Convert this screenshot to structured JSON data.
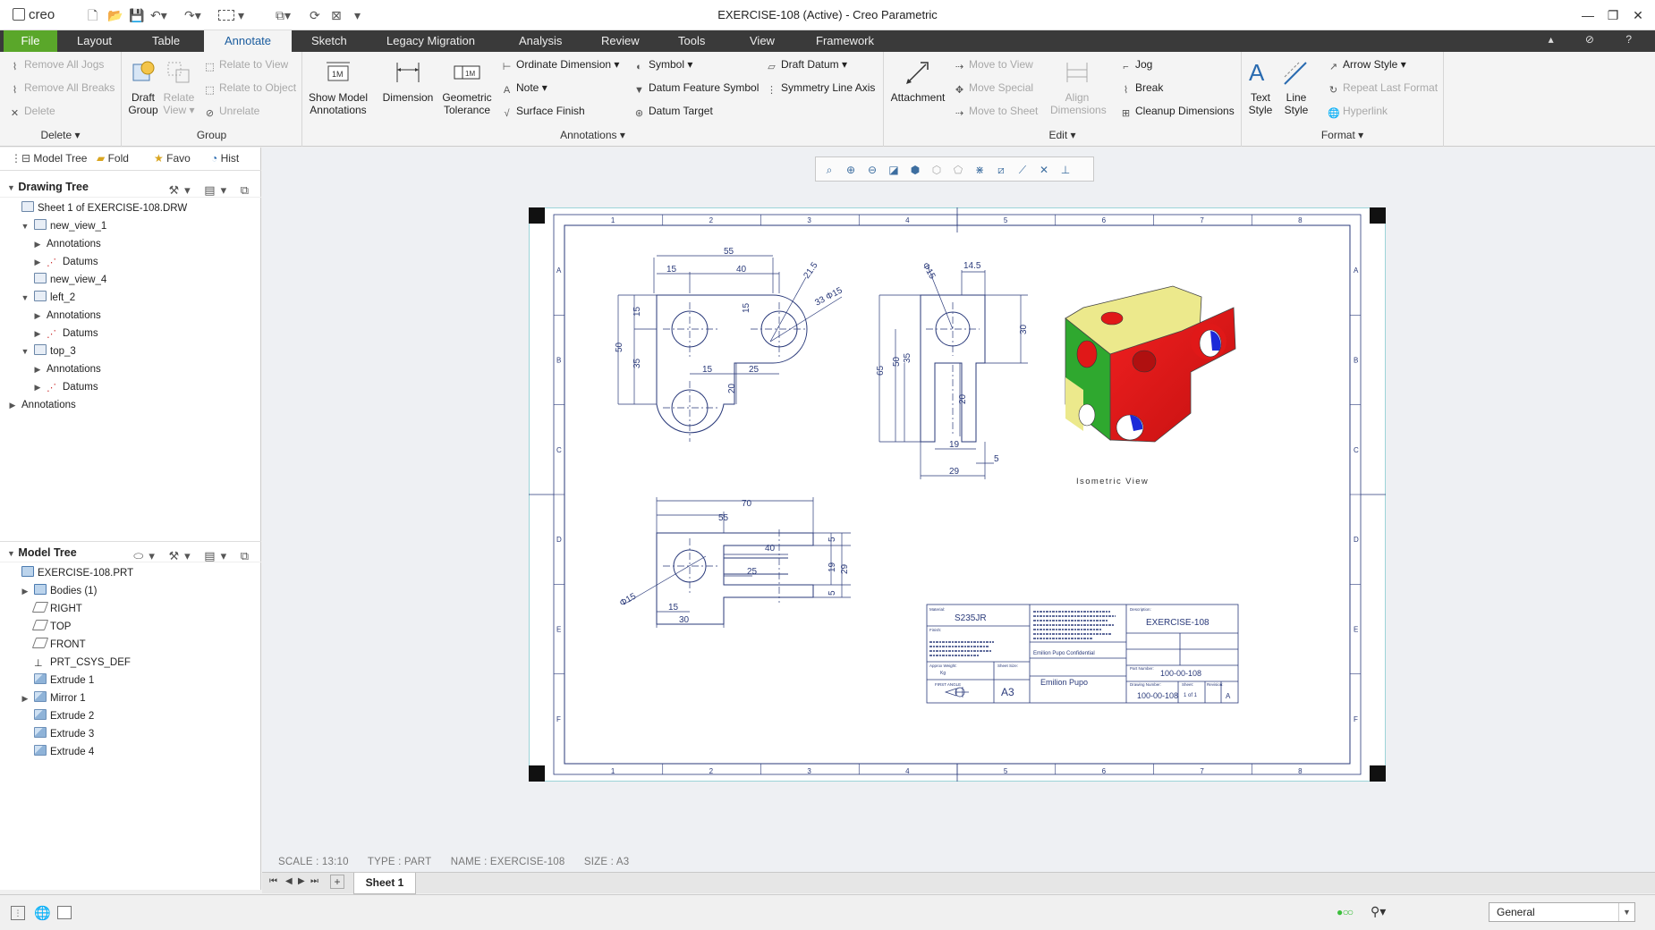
{
  "app": {
    "logo": "creo",
    "window_title": "EXERCISE-108 (Active) - Creo Parametric"
  },
  "tabs": [
    {
      "label": "File"
    },
    {
      "label": "Layout"
    },
    {
      "label": "Table"
    },
    {
      "label": "Annotate"
    },
    {
      "label": "Sketch"
    },
    {
      "label": "Legacy Migration"
    },
    {
      "label": "Analysis"
    },
    {
      "label": "Review"
    },
    {
      "label": "Tools"
    },
    {
      "label": "View"
    },
    {
      "label": "Framework"
    }
  ],
  "active_tab": "Annotate",
  "ribbon": {
    "delete_group": {
      "remove_all_jogs": "Remove All Jogs",
      "remove_all_breaks": "Remove All Breaks",
      "delete": "Delete",
      "label": "Delete"
    },
    "group_group": {
      "draft_group": [
        "Draft",
        "Group"
      ],
      "relate_view": [
        "Relate",
        "View"
      ],
      "relate_to_view": "Relate to View",
      "relate_to_object": "Relate to Object",
      "unrelate": "Unrelate",
      "label": "Group"
    },
    "annotations_group": {
      "show_model_annotations": [
        "Show Model",
        "Annotations"
      ],
      "dimension": "Dimension",
      "geometric_tolerance": [
        "Geometric",
        "Tolerance"
      ],
      "ordinate_dimension": "Ordinate Dimension",
      "note": "Note",
      "surface_finish": "Surface Finish",
      "symbol": "Symbol",
      "datum_feature_symbol": "Datum Feature Symbol",
      "datum_target": "Datum Target",
      "draft_datum": "Draft Datum",
      "symmetry_line_axis": "Symmetry Line Axis",
      "label": "Annotations"
    },
    "edit_group": {
      "attachment": "Attachment",
      "move_to_view": "Move to View",
      "move_special": "Move Special",
      "move_to_sheet": "Move to Sheet",
      "align_dimensions": [
        "Align",
        "Dimensions"
      ],
      "jog": "Jog",
      "break": "Break",
      "cleanup_dimensions": "Cleanup Dimensions",
      "label": "Edit"
    },
    "format_group": {
      "text_style": [
        "Text",
        "Style"
      ],
      "line_style": [
        "Line",
        "Style"
      ],
      "arrow_style": "Arrow Style",
      "repeat_last_format": "Repeat Last Format",
      "hyperlink": "Hyperlink",
      "label": "Format"
    }
  },
  "left_pane": {
    "tabs": [
      {
        "label": "Model Tree",
        "icon": "model-tree-icon"
      },
      {
        "label": "Fold",
        "icon": "folder-icon"
      },
      {
        "label": "Favo",
        "icon": "favorites-icon"
      },
      {
        "label": "Hist",
        "icon": "history-icon"
      }
    ],
    "drawing_tree": {
      "title": "Drawing Tree",
      "items": [
        {
          "label": "Sheet 1 of EXERCISE-108.DRW",
          "icon": "sheet",
          "indent": 0,
          "expander": "none"
        },
        {
          "label": "new_view_1",
          "icon": "view",
          "indent": 1,
          "expander": "open"
        },
        {
          "label": "Annotations",
          "icon": "none",
          "indent": 2,
          "expander": "closed"
        },
        {
          "label": "Datums",
          "icon": "datum",
          "indent": 2,
          "expander": "closed"
        },
        {
          "label": "new_view_4",
          "icon": "view",
          "indent": 1,
          "expander": "none"
        },
        {
          "label": "left_2",
          "icon": "view",
          "indent": 1,
          "expander": "open"
        },
        {
          "label": "Annotations",
          "icon": "none",
          "indent": 2,
          "expander": "closed"
        },
        {
          "label": "Datums",
          "icon": "datum",
          "indent": 2,
          "expander": "closed"
        },
        {
          "label": "top_3",
          "icon": "view",
          "indent": 1,
          "expander": "open"
        },
        {
          "label": "Annotations",
          "icon": "none",
          "indent": 2,
          "expander": "closed"
        },
        {
          "label": "Datums",
          "icon": "datum",
          "indent": 2,
          "expander": "closed"
        },
        {
          "label": "Annotations",
          "icon": "none",
          "indent": 0,
          "expander": "closed"
        }
      ]
    },
    "model_tree": {
      "title": "Model Tree",
      "items": [
        {
          "label": "EXERCISE-108.PRT",
          "icon": "solid",
          "indent": 0,
          "expander": "none"
        },
        {
          "label": "Bodies (1)",
          "icon": "solid",
          "indent": 1,
          "expander": "closed"
        },
        {
          "label": "RIGHT",
          "icon": "plane",
          "indent": 1,
          "expander": "none"
        },
        {
          "label": "TOP",
          "icon": "plane",
          "indent": 1,
          "expander": "none"
        },
        {
          "label": "FRONT",
          "icon": "plane",
          "indent": 1,
          "expander": "none"
        },
        {
          "label": "PRT_CSYS_DEF",
          "icon": "csys",
          "indent": 1,
          "expander": "none"
        },
        {
          "label": "Extrude 1",
          "icon": "feat",
          "indent": 1,
          "expander": "none"
        },
        {
          "label": "Mirror 1",
          "icon": "feat",
          "indent": 1,
          "expander": "closed"
        },
        {
          "label": "Extrude 2",
          "icon": "feat",
          "indent": 1,
          "expander": "none"
        },
        {
          "label": "Extrude 3",
          "icon": "feat",
          "indent": 1,
          "expander": "none"
        },
        {
          "label": "Extrude 4",
          "icon": "feat",
          "indent": 1,
          "expander": "none"
        }
      ]
    }
  },
  "drawing": {
    "front_dims": [
      "55",
      "40",
      "15",
      "21.5",
      "33 Φ15",
      "15",
      "15",
      "50",
      "35",
      "15",
      "25",
      "20"
    ],
    "side_dims": [
      "Φ15",
      "14.5",
      "30",
      "65",
      "50",
      "35",
      "20",
      "19",
      "5",
      "29"
    ],
    "top_dims": [
      "70",
      "55",
      "40",
      "25",
      "Φ15",
      "15",
      "30",
      "5",
      "19",
      "29",
      "5"
    ],
    "border_cols": [
      "1",
      "2",
      "3",
      "4",
      "5",
      "6",
      "7",
      "8"
    ],
    "border_rows": [
      "A",
      "B",
      "C",
      "D",
      "E",
      "F"
    ],
    "iso_label": "Isometric View",
    "title_block": {
      "material_label": "Material:",
      "material": "S235JR",
      "finish_label": "Finish:",
      "approx_weight": "Approx Weight:",
      "weight": "Kg",
      "sheet_size_label": "Sheet Size:",
      "sheet_size": "A3",
      "projection": "FIRST ANGLE",
      "confidential": "Emilion Pupo Confidential",
      "author": "Emilion Pupo",
      "description_label": "Description:",
      "description": "EXERCISE-108",
      "part_number_label": "Part Number:",
      "part_number": "100-00-108",
      "drawing_number_label": "Drawing Number:",
      "drawing_number": "100-00-108",
      "sheet_label": "Sheet:",
      "sheet": "1 of 1",
      "revision_label": "Revision:",
      "revision": "A"
    }
  },
  "status": {
    "scale": "SCALE : 13:10",
    "type": "TYPE : PART",
    "name": "NAME : EXERCISE-108",
    "size": "SIZE : A3"
  },
  "sheet_tab": "Sheet 1",
  "filter": "General",
  "colors": {
    "accent": "#1a5c9e",
    "file_tab": "#5aa72a",
    "tab_bar": "#3a3a3a",
    "part_red": "#e01818",
    "part_yellow": "#ece98c",
    "part_green": "#2fa82f",
    "part_blue": "#1c2ad8"
  }
}
